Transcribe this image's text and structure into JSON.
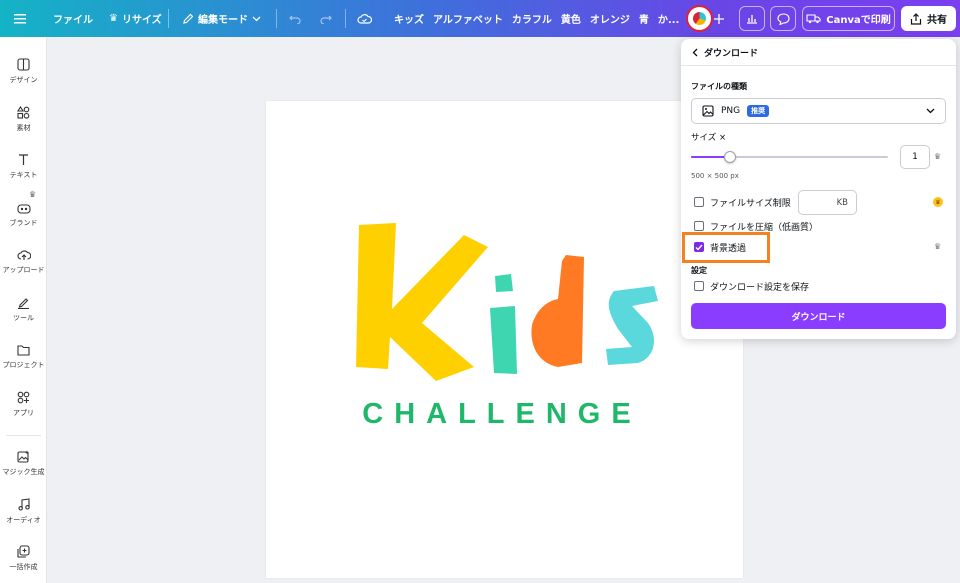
{
  "toolbar": {
    "file": "ファイル",
    "resize": "リサイズ",
    "edit_mode": "編集モード",
    "tags": [
      "キッズ",
      "アルファベット",
      "カラフル",
      "黄色",
      "オレンジ",
      "青",
      "か..."
    ],
    "print": "Canvaで印刷",
    "share": "共有"
  },
  "sidebar": {
    "items": [
      "デザイン",
      "素材",
      "テキスト",
      "ブランド",
      "アップロード",
      "ツール",
      "プロジェクト",
      "アプリ",
      "マジック生成",
      "オーディオ",
      "一括作成"
    ]
  },
  "canvas": {
    "title_letters": [
      "K",
      "i",
      "d",
      "s"
    ],
    "subtitle": "CHALLENGE"
  },
  "panel": {
    "header": "ダウンロード",
    "file_type_label": "ファイルの種類",
    "file_type_value": "PNG",
    "file_type_badge": "推奨",
    "size_label": "サイズ ×",
    "size_value": "1",
    "size_dims": "500 × 500 px",
    "limit_label": "ファイルサイズ制限",
    "limit_unit": "KB",
    "compress_label": "ファイルを圧縮（低画質）",
    "transparent_label": "背景透過",
    "settings_heading": "設定",
    "save_settings_label": "ダウンロード設定を保存",
    "download_button": "ダウンロード",
    "slider_fraction": 0.2
  },
  "colors": {
    "accent": "#8b3dff",
    "highlight": "#f58220",
    "k": "#ffd000",
    "i": "#3ed6b0",
    "d": "#ff7a22",
    "s": "#5ad8dc",
    "challenge": "#1fb86a"
  }
}
